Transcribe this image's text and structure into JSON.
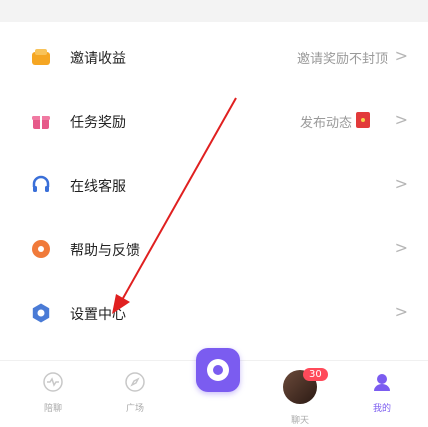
{
  "menu": {
    "items": [
      {
        "label": "邀请收益",
        "right_text": "邀请奖励不封顶",
        "icon": "wallet-icon",
        "icon_color": "#f5a623"
      },
      {
        "label": "任务奖励",
        "right_text": "发布动态",
        "icon": "gift-icon",
        "icon_color": "#e65a8a"
      },
      {
        "label": "在线客服",
        "right_text": "",
        "icon": "headset-icon",
        "icon_color": "#3a6fd8"
      },
      {
        "label": "帮助与反馈",
        "right_text": "",
        "icon": "help-icon",
        "icon_color": "#f07a3a"
      },
      {
        "label": "设置中心",
        "right_text": "",
        "icon": "settings-icon",
        "icon_color": "#4a7bd6"
      }
    ],
    "chevron": ">"
  },
  "bottom_nav": {
    "items": [
      {
        "label": "陪聊",
        "icon": "heart-pulse-icon"
      },
      {
        "label": "广场",
        "icon": "compass-icon"
      },
      {
        "label": "",
        "icon": "center-create-icon"
      },
      {
        "label": "聊天",
        "icon": "chat-avatar"
      },
      {
        "label": "我的",
        "icon": "profile-icon"
      }
    ],
    "badge_count": "30",
    "accent_color": "#7b5cf0"
  }
}
